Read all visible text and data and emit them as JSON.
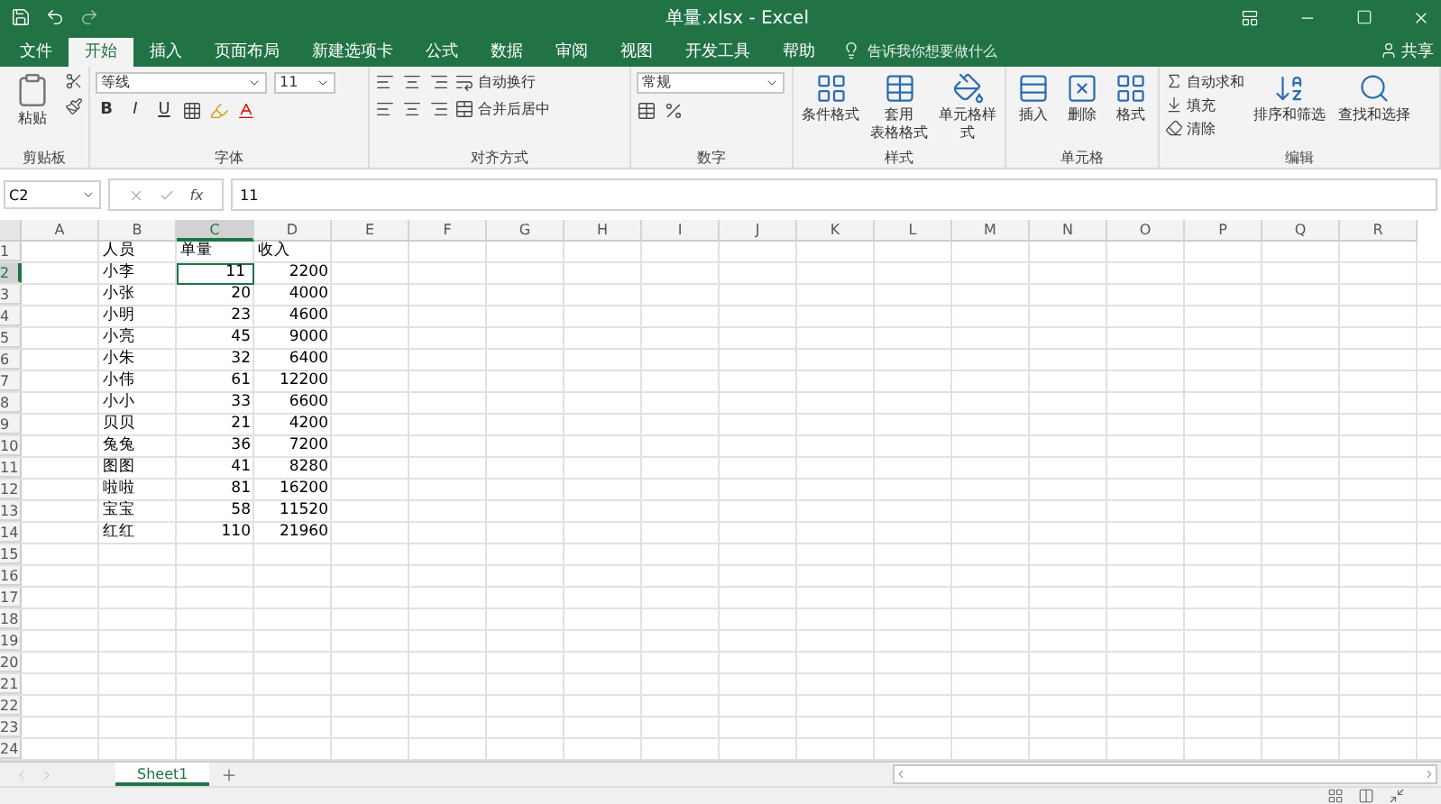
{
  "window": {
    "title": "单量.xlsx - Excel"
  },
  "ribbon_tabs": [
    {
      "label": "文件",
      "selected": false
    },
    {
      "label": "开始",
      "selected": true
    },
    {
      "label": "插入",
      "selected": false
    },
    {
      "label": "页面布局",
      "selected": false
    },
    {
      "label": "新建选项卡",
      "selected": false
    },
    {
      "label": "公式",
      "selected": false
    },
    {
      "label": "数据",
      "selected": false
    },
    {
      "label": "审阅",
      "selected": false
    },
    {
      "label": "视图",
      "selected": false
    },
    {
      "label": "开发工具",
      "selected": false
    },
    {
      "label": "帮助",
      "selected": false
    }
  ],
  "tell_me": {
    "placeholder": "告诉我你想要做什么"
  },
  "share": "共享",
  "groups": {
    "clipboard": {
      "title": "剪贴板",
      "paste": "粘贴"
    },
    "font": {
      "title": "字体",
      "name": "等线",
      "size": "11",
      "bold": "B",
      "italic": "I",
      "underline": "U"
    },
    "alignment": {
      "title": "对齐方式",
      "wrap": "自动换行",
      "merge": "合并后居中"
    },
    "number": {
      "title": "数字",
      "format": "常规"
    },
    "styles": {
      "title": "样式",
      "buttons": [
        {
          "lines": [
            "条件格式"
          ]
        },
        {
          "lines": [
            "套用",
            "表格格式"
          ]
        },
        {
          "lines": [
            "单元格样式"
          ]
        }
      ]
    },
    "cells": {
      "title": "单元格",
      "buttons": [
        "插入",
        "删除",
        "格式"
      ]
    },
    "editing": {
      "title": "编辑",
      "small": [
        "自动求和",
        "填充",
        "清除"
      ],
      "large": [
        "排序和筛选",
        "查找和选择"
      ]
    }
  },
  "formula_bar": {
    "name_box": "C2",
    "fx": "fx",
    "value": "11"
  },
  "columns": [
    {
      "label": "A",
      "selected": false
    },
    {
      "label": "B",
      "selected": false
    },
    {
      "label": "C",
      "selected": true
    },
    {
      "label": "D",
      "selected": false
    },
    {
      "label": "E",
      "selected": false
    },
    {
      "label": "F",
      "selected": false
    },
    {
      "label": "G",
      "selected": false
    },
    {
      "label": "H",
      "selected": false
    },
    {
      "label": "I",
      "selected": false
    },
    {
      "label": "J",
      "selected": false
    },
    {
      "label": "K",
      "selected": false
    },
    {
      "label": "L",
      "selected": false
    },
    {
      "label": "M",
      "selected": false
    },
    {
      "label": "N",
      "selected": false
    },
    {
      "label": "O",
      "selected": false
    },
    {
      "label": "P",
      "selected": false
    },
    {
      "label": "Q",
      "selected": false
    },
    {
      "label": "R",
      "selected": false
    }
  ],
  "rows": [
    {
      "number": "1",
      "selected": false,
      "kind": "header",
      "name": "人员",
      "qty": "单量",
      "income": "收入"
    },
    {
      "number": "2",
      "selected": true,
      "kind": "data",
      "name": "小李",
      "qty": "11",
      "income": "2200"
    },
    {
      "number": "3",
      "selected": false,
      "kind": "data",
      "name": "小张",
      "qty": "20",
      "income": "4000"
    },
    {
      "number": "4",
      "selected": false,
      "kind": "data",
      "name": "小明",
      "qty": "23",
      "income": "4600"
    },
    {
      "number": "5",
      "selected": false,
      "kind": "data",
      "name": "小亮",
      "qty": "45",
      "income": "9000"
    },
    {
      "number": "6",
      "selected": false,
      "kind": "data",
      "name": "小朱",
      "qty": "32",
      "income": "6400"
    },
    {
      "number": "7",
      "selected": false,
      "kind": "data",
      "name": "小伟",
      "qty": "61",
      "income": "12200"
    },
    {
      "number": "8",
      "selected": false,
      "kind": "data",
      "name": "小小",
      "qty": "33",
      "income": "6600"
    },
    {
      "number": "9",
      "selected": false,
      "kind": "data",
      "name": "贝贝",
      "qty": "21",
      "income": "4200"
    },
    {
      "number": "10",
      "selected": false,
      "kind": "data",
      "name": "兔兔",
      "qty": "36",
      "income": "7200"
    },
    {
      "number": "11",
      "selected": false,
      "kind": "data",
      "name": "图图",
      "qty": "41",
      "income": "8280"
    },
    {
      "number": "12",
      "selected": false,
      "kind": "data",
      "name": "啦啦",
      "qty": "81",
      "income": "16200"
    },
    {
      "number": "13",
      "selected": false,
      "kind": "data",
      "name": "宝宝",
      "qty": "58",
      "income": "11520"
    },
    {
      "number": "14",
      "selected": false,
      "kind": "data",
      "name": "红红",
      "qty": "110",
      "income": "21960"
    },
    {
      "number": "15",
      "selected": false,
      "kind": "empty"
    },
    {
      "number": "16",
      "selected": false,
      "kind": "empty"
    },
    {
      "number": "17",
      "selected": false,
      "kind": "empty"
    },
    {
      "number": "18",
      "selected": false,
      "kind": "empty"
    },
    {
      "number": "19",
      "selected": false,
      "kind": "empty"
    },
    {
      "number": "20",
      "selected": false,
      "kind": "empty"
    },
    {
      "number": "21",
      "selected": false,
      "kind": "empty"
    },
    {
      "number": "22",
      "selected": false,
      "kind": "empty"
    },
    {
      "number": "23",
      "selected": false,
      "kind": "empty"
    },
    {
      "number": "24",
      "selected": false,
      "kind": "empty"
    }
  ],
  "sheets": [
    {
      "label": "Sheet1",
      "selected": true
    }
  ]
}
